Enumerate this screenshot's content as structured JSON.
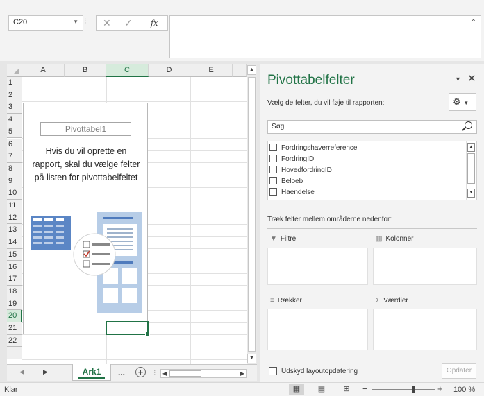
{
  "formula_bar": {
    "name_box": "C20",
    "fx_label": "fx"
  },
  "grid": {
    "columns": [
      "A",
      "B",
      "C",
      "D",
      "E"
    ],
    "rows": [
      "1",
      "2",
      "3",
      "4",
      "5",
      "6",
      "7",
      "8",
      "9",
      "10",
      "11",
      "12",
      "13",
      "14",
      "15",
      "16",
      "17",
      "18",
      "19",
      "20",
      "21",
      "22"
    ],
    "selected_cell": "C20"
  },
  "pivot_placeholder": {
    "name": "Pivottabel1",
    "message_line1": "Hvis du vil oprette en",
    "message_line2": "rapport, skal du vælge felter",
    "message_line3": "på listen for pivottabelfeltet"
  },
  "sheet_tabs": {
    "active": "Ark1",
    "more": "..."
  },
  "status_bar": {
    "ready": "Klar",
    "zoom": "100 %"
  },
  "pane": {
    "title": "Pivottabelfelter",
    "instruction": "Vælg de felter, du vil føje til rapporten:",
    "search_placeholder": "Søg",
    "fields": [
      "Fordringshaverreference",
      "FordringID",
      "HovedfordringID",
      "Beloeb",
      "Haendelse"
    ],
    "drag_instruction": "Træk felter mellem områderne nedenfor:",
    "areas": {
      "filters": "Filtre",
      "columns": "Kolonner",
      "rows": "Rækker",
      "values": "Værdier"
    },
    "defer_label": "Udskyd layoutopdatering",
    "update_button": "Opdater"
  }
}
